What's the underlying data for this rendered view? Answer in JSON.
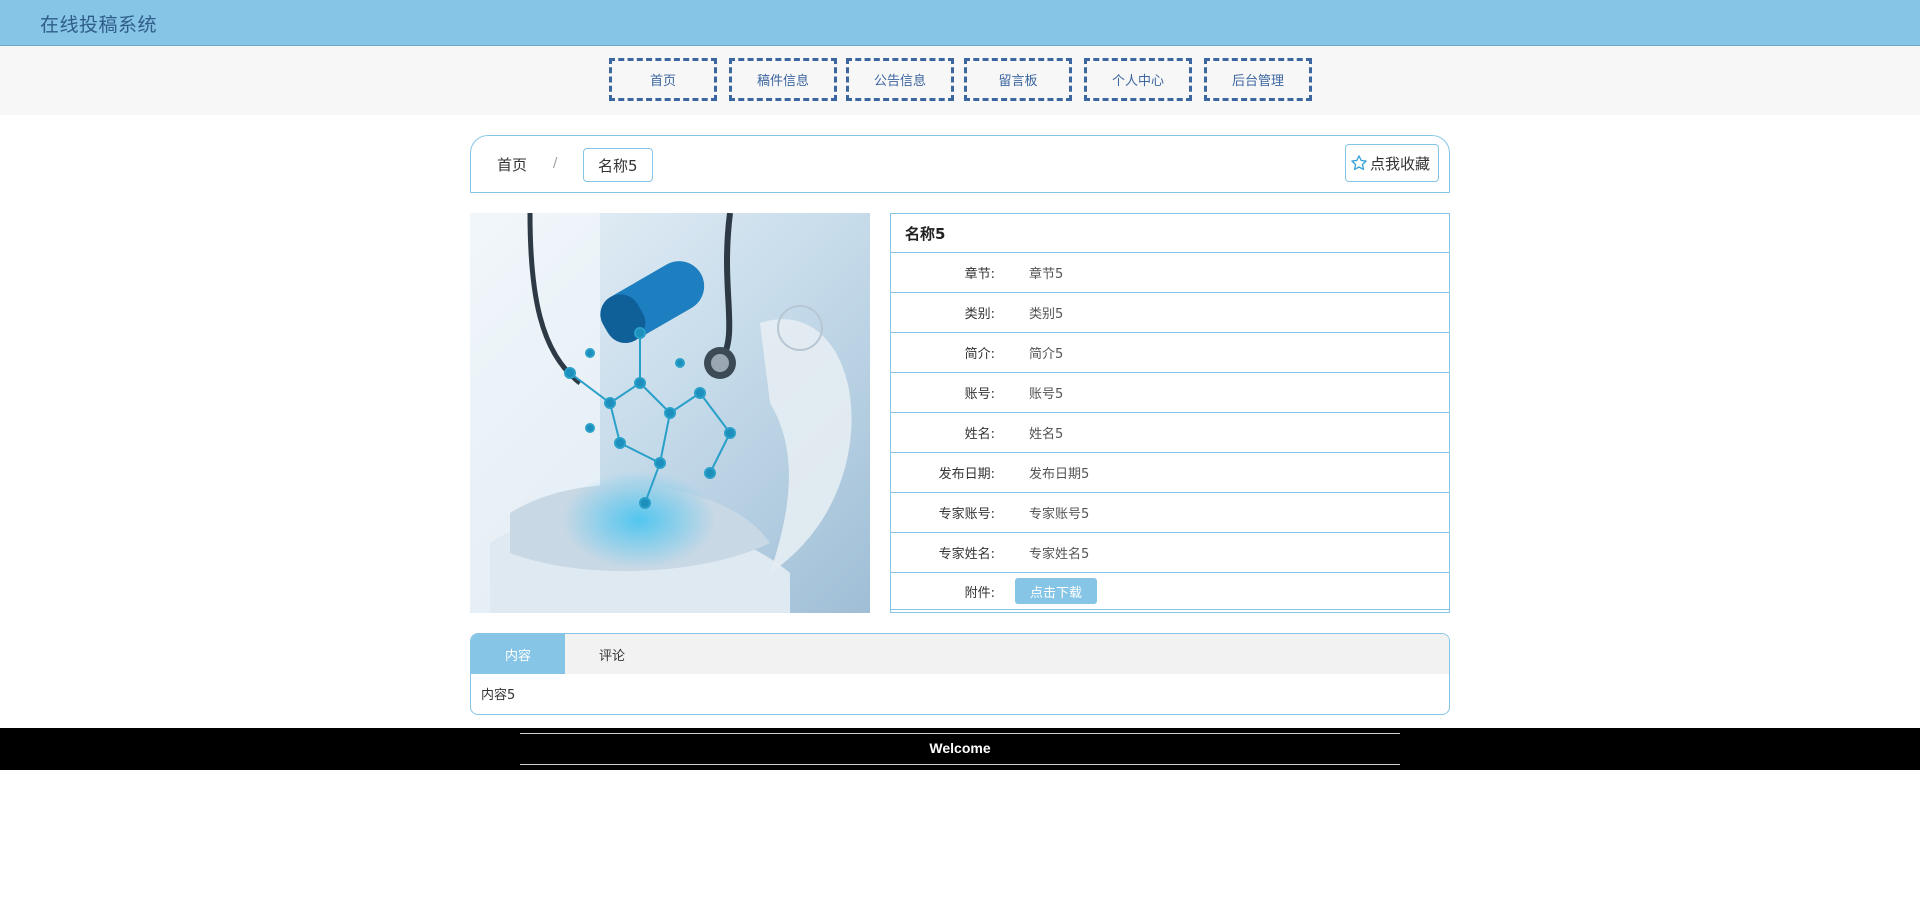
{
  "header": {
    "brand": "在线投稿系统"
  },
  "nav": {
    "items": [
      {
        "label": "首页"
      },
      {
        "label": "稿件信息"
      },
      {
        "label": "公告信息"
      },
      {
        "label": "留言板"
      },
      {
        "label": "个人中心"
      },
      {
        "label": "后台管理"
      }
    ]
  },
  "breadcrumb": {
    "home": "首页",
    "separator": "/",
    "current": "名称5",
    "favorite_label": "点我收藏"
  },
  "detail": {
    "title": "名称5",
    "rows": [
      {
        "label": "章节:",
        "value": "章节5"
      },
      {
        "label": "类别:",
        "value": "类别5"
      },
      {
        "label": "简介:",
        "value": "简介5"
      },
      {
        "label": "账号:",
        "value": "账号5"
      },
      {
        "label": "姓名:",
        "value": "姓名5"
      },
      {
        "label": "发布日期:",
        "value": "发布日期5"
      },
      {
        "label": "专家账号:",
        "value": "专家账号5"
      },
      {
        "label": "专家姓名:",
        "value": "专家姓名5"
      }
    ],
    "attachment": {
      "label": "附件:",
      "button": "点击下载"
    }
  },
  "tabs": {
    "items": [
      {
        "label": "内容"
      },
      {
        "label": "评论"
      }
    ],
    "content": "内容5"
  },
  "footer": {
    "text": "Welcome"
  },
  "colors": {
    "accent": "#87c5e6",
    "nav_border": "#3c66a0",
    "brand_text": "#2f5d8a"
  }
}
